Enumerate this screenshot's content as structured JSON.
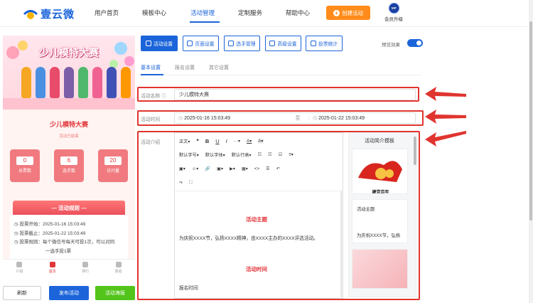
{
  "brand": {
    "name": "壹云微",
    "color": "#1b64da"
  },
  "nav": {
    "items": [
      "用户首页",
      "模板中心",
      "活动管理",
      "定制服务",
      "帮助中心"
    ],
    "active_index": 2,
    "create_label": "创建活动",
    "vip_badge": "VIP",
    "vip_label": "会员升级"
  },
  "preview": {
    "hero_title": "少儿模特大赛",
    "title": "少儿模特大赛",
    "status": "活动已结束",
    "stats": [
      {
        "value": "0",
        "label": "总票数"
      },
      {
        "value": "6",
        "label": "选手数"
      },
      {
        "value": "20",
        "label": "访问量"
      }
    ],
    "rules_title": "— 活动规则 —",
    "rules": [
      "投票开始：2025-01-16 15:03:49",
      "投票截止：2025-01-22 15:03:49",
      "投票规则：每个微信号每天可投1次，可以对同",
      "一选手投1票"
    ],
    "tabs": [
      "介绍",
      "首页",
      "排行",
      "报名"
    ],
    "active_tab": 1,
    "refresh_label": "刷新",
    "publish_label": "发布活动",
    "poster_label": "活动海报"
  },
  "toolbar": {
    "buttons": [
      "活动设置",
      "页面设置",
      "选手管理",
      "高级设置",
      "投票统计"
    ],
    "active_index": 0,
    "preview_label": "预览效果",
    "preview_on": true
  },
  "subtabs": {
    "items": [
      "基本设置",
      "报名设置",
      "其它设置"
    ],
    "active_index": 0
  },
  "form": {
    "name_label": "活动名称",
    "name_value": "少儿模特大赛",
    "time_label": "活动时间",
    "start_time": "2025-01-16 15:03:49",
    "to_label": "至",
    "end_time": "2025-01-22 15:03:49",
    "intro_label": "活动介绍"
  },
  "editor": {
    "row1": [
      "正文▾",
      "❝",
      "B",
      "U",
      "I",
      "···▾",
      "A▾",
      "A▾"
    ],
    "row2": [
      "默认字号▾",
      "默认字体▾",
      "默认行高▾",
      "☷",
      "☷",
      "☑",
      "≡▾"
    ],
    "row3": [
      "▣▾",
      "☺▾",
      "🔗",
      "▣▾",
      "▶▾",
      "▦▾",
      "<>",
      "☰",
      "↶"
    ],
    "row4": [
      "↷",
      "⛶"
    ],
    "section1_title": "活动主题",
    "section1_text": "为庆祝XXXX节，弘扬XXXX精神，由XXXX主办的XXXX评选活动。",
    "section2_title": "活动时间",
    "section2_text": "报名时间:"
  },
  "template_panel": {
    "title": "活动简介模板",
    "card1_caption": "建党百年",
    "card2_title": "活动主题",
    "card2_text": "为庆祝XXXX节，弘扬"
  },
  "colors": {
    "accent": "#1b64da",
    "orange": "#ff8c1a",
    "red": "#e0342f",
    "green": "#52c41a"
  }
}
